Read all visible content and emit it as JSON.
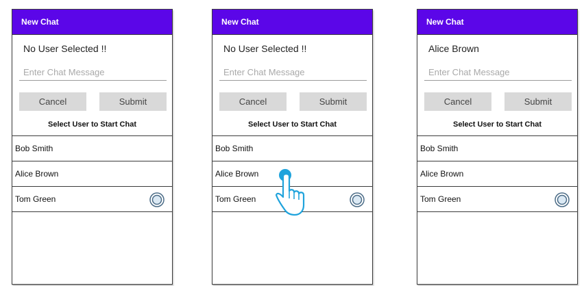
{
  "screens": [
    {
      "header_title": "New Chat",
      "selected_user": "No User Selected !!",
      "message_placeholder": "Enter Chat Message",
      "cancel_label": "Cancel",
      "submit_label": "Submit",
      "prompt": "Select User to Start Chat",
      "users": [
        "Bob Smith",
        "Alice Brown",
        "Tom Green"
      ]
    },
    {
      "header_title": "New Chat",
      "selected_user": "No User Selected !!",
      "message_placeholder": "Enter Chat Message",
      "cancel_label": "Cancel",
      "submit_label": "Submit",
      "prompt": "Select User to Start Chat",
      "users": [
        "Bob Smith",
        "Alice Brown",
        "Tom Green"
      ]
    },
    {
      "header_title": "New Chat",
      "selected_user": "Alice Brown",
      "message_placeholder": "Enter Chat Message",
      "cancel_label": "Cancel",
      "submit_label": "Submit",
      "prompt": "Select User to Start Chat",
      "users": [
        "Bob Smith",
        "Alice Brown",
        "Tom Green"
      ]
    }
  ],
  "icons": {
    "row_indicator": "radio-button-icon",
    "gesture": "tap-gesture-icon"
  },
  "colors": {
    "header_bg": "#5b06e8",
    "button_bg": "#d9d9d9",
    "tap_accent": "#1fa3dc"
  }
}
